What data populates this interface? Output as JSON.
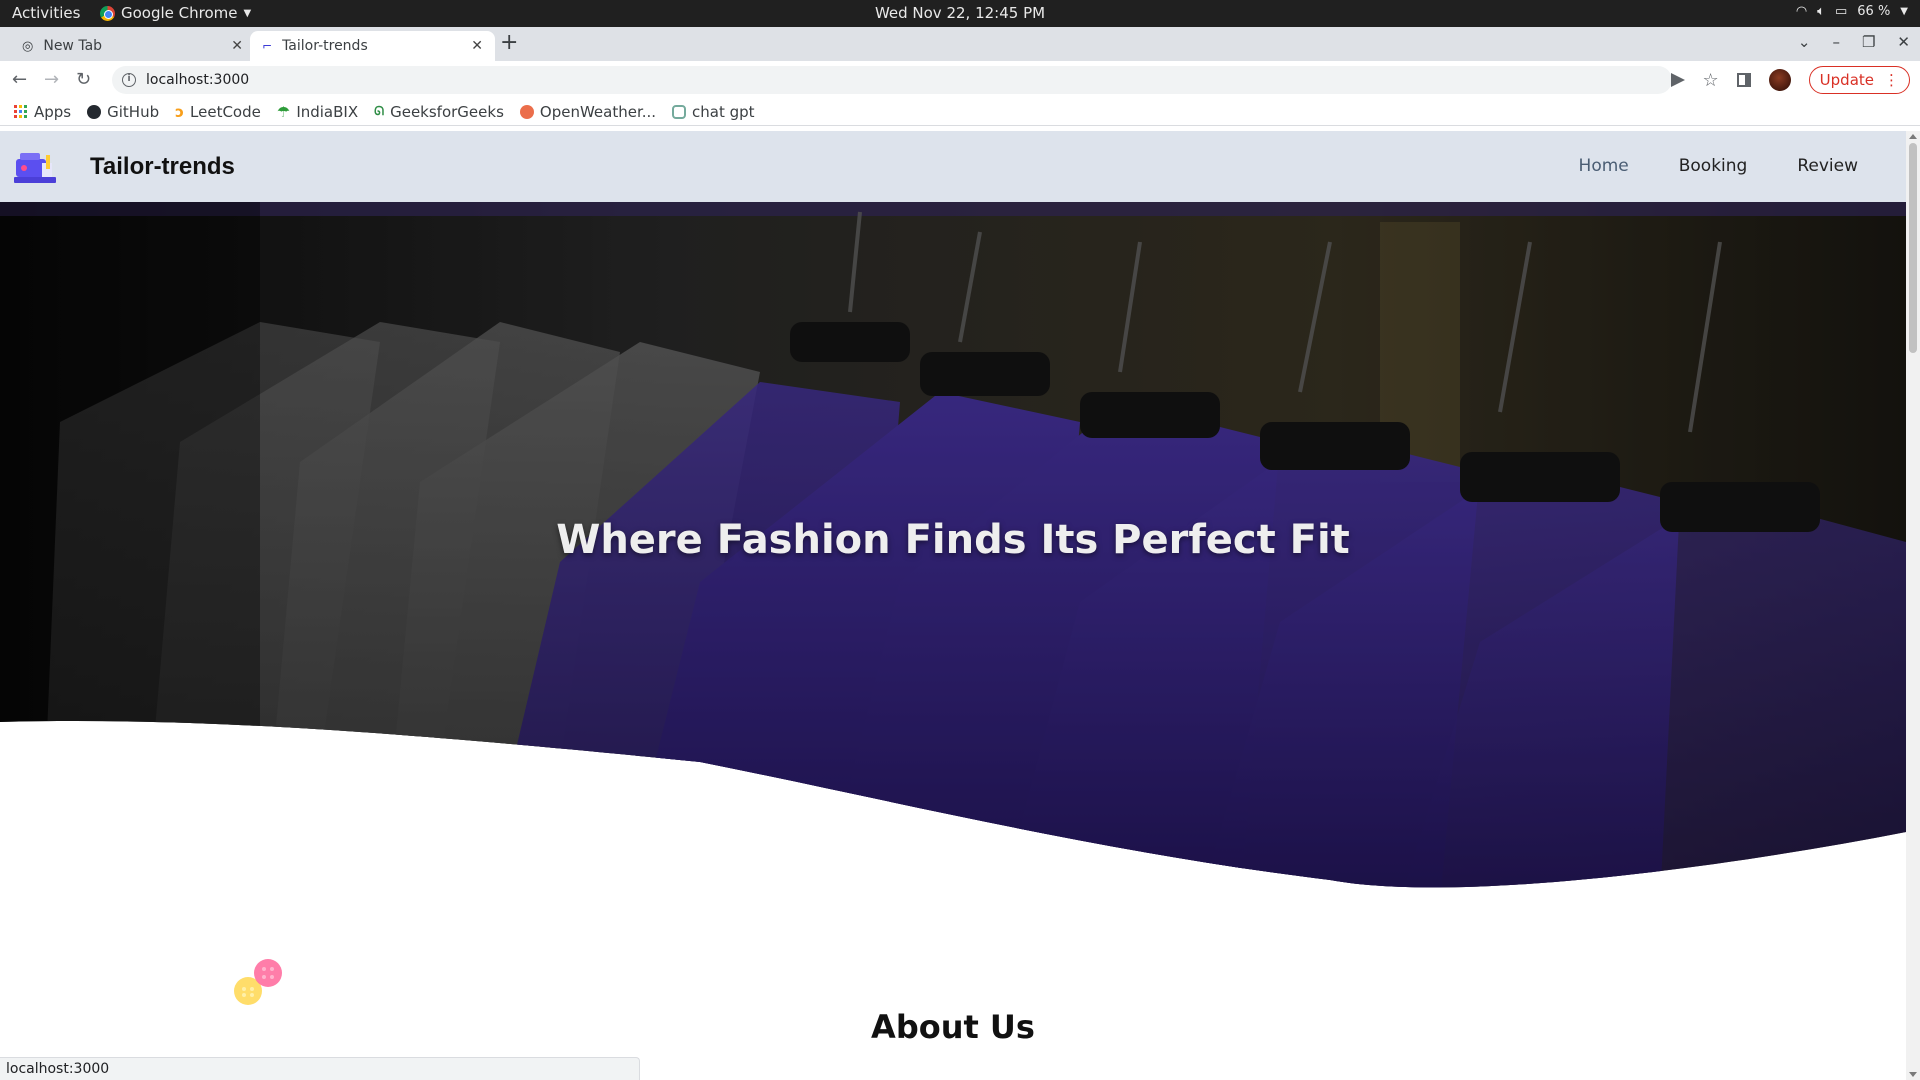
{
  "os": {
    "activities": "Activities",
    "app_name": "Google Chrome",
    "clock": "Wed Nov 22, 12:45 PM",
    "battery": "66 %"
  },
  "tabs": [
    {
      "title": "New Tab",
      "active": false
    },
    {
      "title": "Tailor-trends",
      "active": true
    }
  ],
  "toolbar": {
    "url": "localhost:3000",
    "update_label": "Update"
  },
  "bookmarks": [
    {
      "label": "Apps",
      "icon": "apps-grid-icon"
    },
    {
      "label": "GitHub",
      "icon": "github-icon"
    },
    {
      "label": "LeetCode",
      "icon": "leetcode-icon"
    },
    {
      "label": "IndiaBIX",
      "icon": "indiabix-icon"
    },
    {
      "label": "GeeksforGeeks",
      "icon": "geeksforgeeks-icon"
    },
    {
      "label": "OpenWeather...",
      "icon": "openweather-icon"
    },
    {
      "label": "chat gpt",
      "icon": "chatgpt-icon"
    }
  ],
  "site": {
    "brand": "Tailor-trends",
    "nav": [
      {
        "label": "Home",
        "active": true
      },
      {
        "label": "Booking",
        "active": false
      },
      {
        "label": "Review",
        "active": false
      }
    ],
    "hero_title": "Where Fashion Finds Its Perfect Fit",
    "about_title": "About Us",
    "accent_color": "#3b2a8c"
  },
  "status_bar": {
    "link_preview": "localhost:3000"
  }
}
